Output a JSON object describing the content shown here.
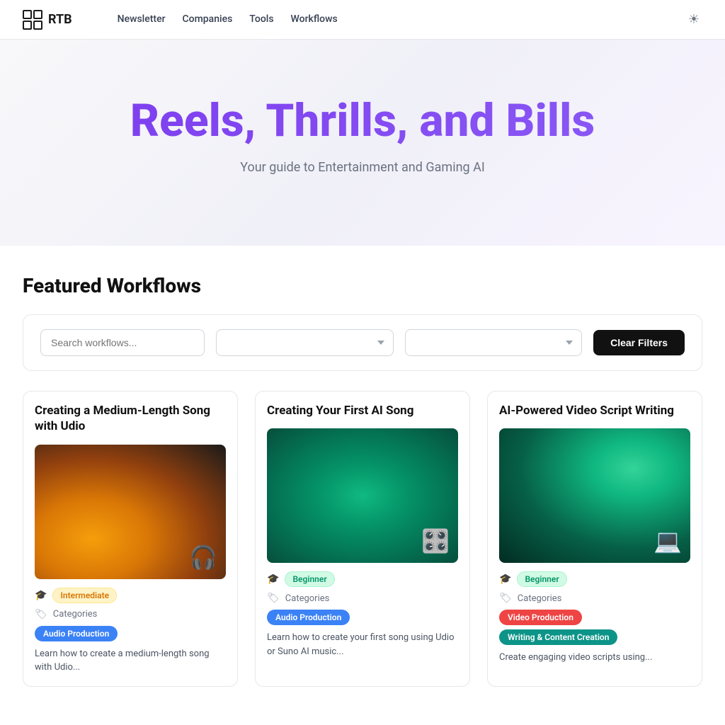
{
  "nav": {
    "logo_text": "RTB",
    "links": [
      "Newsletter",
      "Companies",
      "Tools",
      "Workflows"
    ],
    "theme_icon": "☀"
  },
  "hero": {
    "title": "Reels, Thrills, and Bills",
    "subtitle": "Your guide to Entertainment and Gaming AI"
  },
  "section": {
    "title": "Featured Workflows"
  },
  "filters": {
    "search_placeholder": "Search workflows...",
    "select1_placeholder": "",
    "select2_placeholder": "",
    "clear_label": "Clear Filters"
  },
  "cards": [
    {
      "title": "Creating a Medium-Length Song with Udio",
      "level": "Intermediate",
      "level_type": "yellow",
      "categories_label": "Categories",
      "tags": [
        {
          "label": "Audio Production",
          "type": "blue"
        }
      ],
      "description": "Learn how to create a medium-length song with Udio...",
      "image_type": "udio"
    },
    {
      "title": "Creating Your First AI Song",
      "level": "Beginner",
      "level_type": "green",
      "categories_label": "Categories",
      "tags": [
        {
          "label": "Audio Production",
          "type": "blue"
        }
      ],
      "description": "Learn how to create your first song using Udio or Suno AI music...",
      "image_type": "ai-song"
    },
    {
      "title": "AI-Powered Video Script Writing",
      "level": "Beginner",
      "level_type": "green",
      "categories_label": "Categories",
      "tags": [
        {
          "label": "Video Production",
          "type": "red"
        },
        {
          "label": "Writing & Content Creation",
          "type": "teal"
        }
      ],
      "description": "Create engaging video scripts using...",
      "image_type": "script"
    }
  ]
}
